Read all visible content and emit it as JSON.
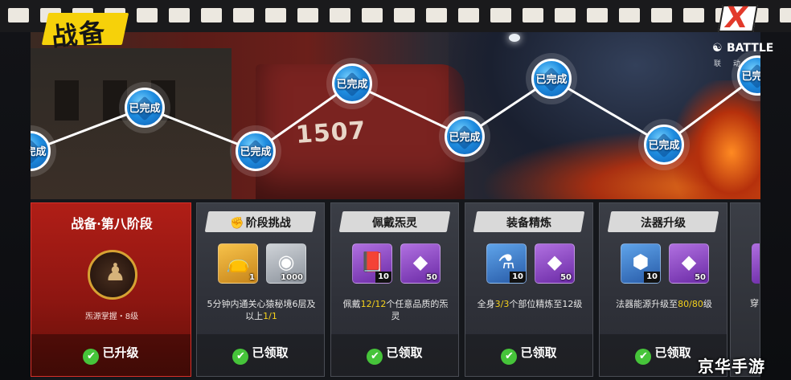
{
  "header": {
    "title": "战备",
    "close_glyph": "X",
    "battle_label": "BATTLE",
    "battle_sub": "联 动 中"
  },
  "scene": {
    "train_number": "1507"
  },
  "progress_nodes": [
    {
      "label": "已完成"
    },
    {
      "label": "已完成"
    },
    {
      "label": "已完成"
    },
    {
      "label": "已完成"
    },
    {
      "label": "已完成"
    },
    {
      "label": "已完成"
    },
    {
      "label": "已完成"
    },
    {
      "label": "已完成"
    }
  ],
  "stage_card": {
    "title": "战备·第八阶段",
    "emblem_caption": "炁源掌握・8级",
    "status": "已升级"
  },
  "task_cards": [
    {
      "title": "阶段挑战",
      "icon": "fist-icon",
      "items": [
        {
          "icon": "treasure-bag-icon",
          "qty": "1",
          "color": "#f7c24a"
        },
        {
          "icon": "silver-coin-icon",
          "qty": "1000",
          "color": "#cfd3d8"
        }
      ],
      "desc_pre": "5分钟内通关心猿秘境6层及以上",
      "desc_hl": "1/1",
      "desc_post": "",
      "status": "已领取"
    },
    {
      "title": "佩戴炁灵",
      "items": [
        {
          "icon": "red-book-icon",
          "qty": "10",
          "color": "#b070e0"
        },
        {
          "icon": "blue-crystal-icon",
          "qty": "50",
          "color": "#b070e0"
        }
      ],
      "desc_pre": "佩戴",
      "desc_hl": "12/12",
      "desc_post": "个任意品质的炁灵",
      "status": "已领取"
    },
    {
      "title": "装备精炼",
      "items": [
        {
          "icon": "potion-icon",
          "qty": "10",
          "color": "#5fa4ea"
        },
        {
          "icon": "blue-crystal-icon",
          "qty": "50",
          "color": "#b070e0"
        }
      ],
      "desc_pre": "全身",
      "desc_hl": "3/3",
      "desc_post": "个部位精炼至12级",
      "status": "已领取"
    },
    {
      "title": "法器升级",
      "items": [
        {
          "icon": "cube-icon",
          "qty": "10",
          "color": "#5fa4ea"
        },
        {
          "icon": "blue-crystal-icon",
          "qty": "50",
          "color": "#b070e0"
        }
      ],
      "desc_pre": "法器能源升级至",
      "desc_hl": "80/80",
      "desc_post": "级",
      "status": "已领取"
    }
  ],
  "partial_card": {
    "text": "穿"
  },
  "watermark": "京华手游",
  "colors": {
    "accent_yellow": "#f6d10a",
    "highlight": "#f5d21b",
    "check_green": "#46c43a",
    "stage_red": "#b01e17",
    "node_blue": "#1f8de0"
  }
}
